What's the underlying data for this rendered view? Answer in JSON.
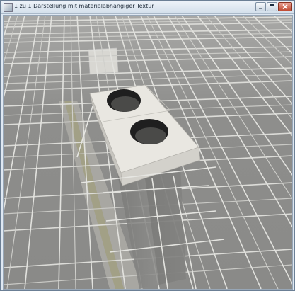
{
  "window": {
    "title": "1 zu 1 Darstellung mit materialabhängiger Textur",
    "app_icon": "app-icon",
    "controls": {
      "minimize_icon": "minimize-icon",
      "maximize_icon": "maximize-icon",
      "close_icon": "close-icon"
    }
  },
  "viewport": {
    "scene_colors": {
      "floor": "#8d8d8b",
      "rebar": "#d9d9d6",
      "block_top": "#e9e7e1",
      "block_side": "#c7c5bf",
      "shadow": "#6f6f6d",
      "formwork": "#9c9a6f"
    }
  }
}
